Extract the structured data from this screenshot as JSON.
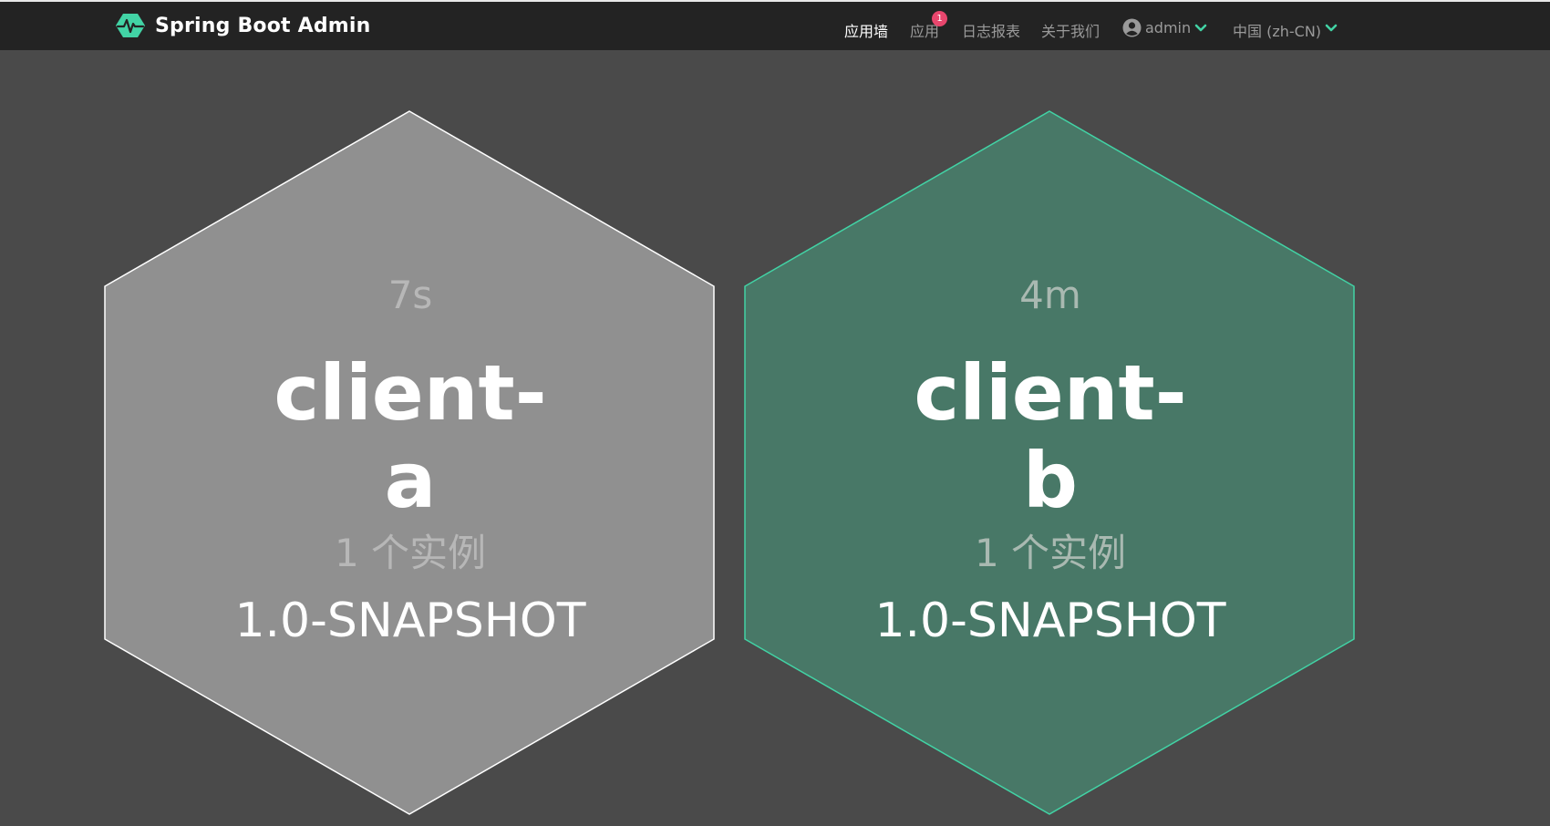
{
  "brand": {
    "title": "Spring Boot Admin",
    "logo_icon": "heartbeat-hexagon-icon",
    "accent_color": "#42d3a5"
  },
  "nav": {
    "wallboard": "应用墙",
    "applications": "应用",
    "applications_badge": "1",
    "journal": "日志报表",
    "about": "关于我们",
    "user": "admin",
    "language": "中国 (zh-CN)"
  },
  "applications": [
    {
      "uptime": "7s",
      "name_line1": "client-",
      "name_line2": "a",
      "instances": "1 个实例",
      "version": "1.0-SNAPSHOT",
      "fill_color": "#909090",
      "stroke_color": "#ffffff"
    },
    {
      "uptime": "4m",
      "name_line1": "client-",
      "name_line2": "b",
      "instances": "1 个实例",
      "version": "1.0-SNAPSHOT",
      "fill_color": "#487867",
      "stroke_color": "#42d3a5"
    }
  ]
}
